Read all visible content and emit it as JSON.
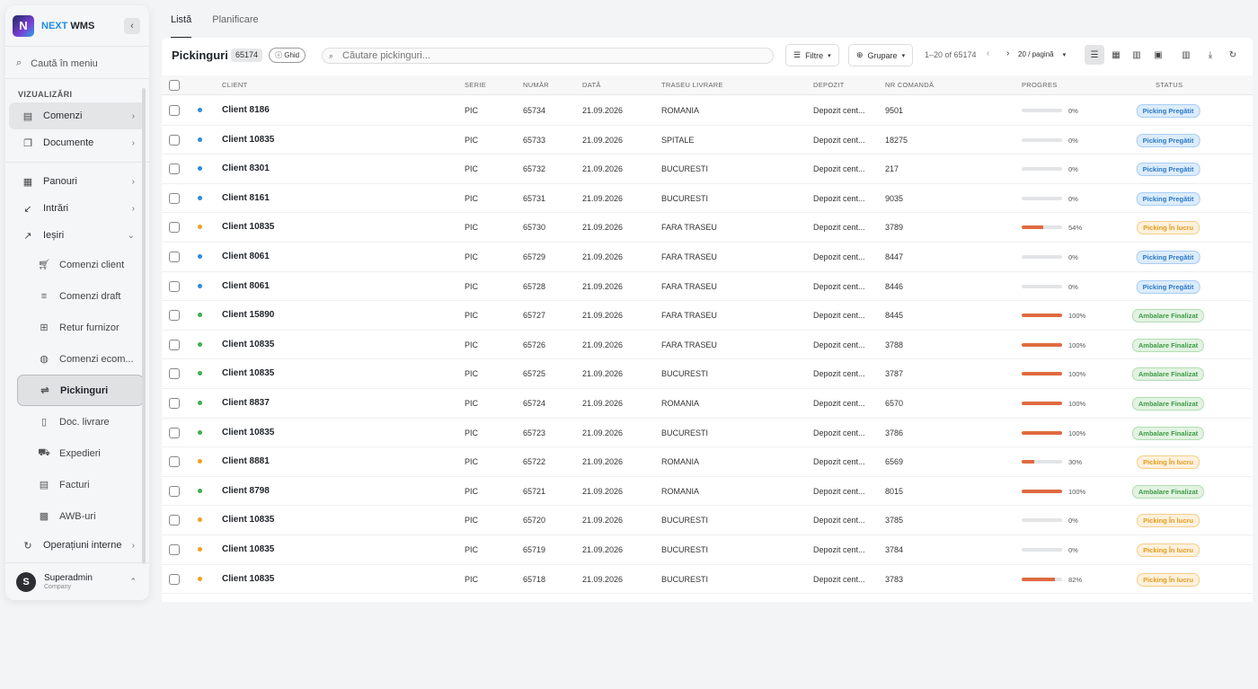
{
  "app": {
    "brand_prefix": "NEXT",
    "brand_suffix": "WMS",
    "logo_letter": "N"
  },
  "sidebar": {
    "search_placeholder": "Caută în meniu",
    "section_label": "VIZUALIZĂRI",
    "items": [
      {
        "label": "Comenzi",
        "icon": "list-box-icon"
      },
      {
        "label": "Documente",
        "icon": "documents-icon"
      },
      {
        "label": "Panouri",
        "icon": "dashboard-icon"
      },
      {
        "label": "Intrări",
        "icon": "arrow-in-icon"
      },
      {
        "label": "Ieșiri",
        "icon": "arrow-out-icon"
      }
    ],
    "sub_items": [
      {
        "label": "Comenzi client",
        "icon": "cart-icon"
      },
      {
        "label": "Comenzi draft",
        "icon": "draft-icon"
      },
      {
        "label": "Retur furnizor",
        "icon": "return-icon"
      },
      {
        "label": "Comenzi ecom...",
        "icon": "globe-icon"
      },
      {
        "label": "Pickinguri",
        "icon": "picking-icon"
      },
      {
        "label": "Doc. livrare",
        "icon": "delivery-doc-icon"
      },
      {
        "label": "Expedieri",
        "icon": "truck-icon"
      },
      {
        "label": "Facturi",
        "icon": "invoice-icon"
      },
      {
        "label": "AWB-uri",
        "icon": "qr-icon"
      }
    ],
    "last_item": {
      "label": "Operațiuni interne",
      "icon": "operations-icon"
    },
    "user": {
      "initial": "S",
      "name": "Superadmin",
      "company": "Company"
    }
  },
  "tabs": [
    {
      "label": "Listă"
    },
    {
      "label": "Planificare"
    }
  ],
  "toolbar": {
    "title": "Pickinguri",
    "count": "65174",
    "guide_label": "Ghid",
    "search_placeholder": "Căutare pickinguri...",
    "filter_label": "Filtre",
    "group_label": "Grupare",
    "page_info": "1–20 of 65174",
    "page_size": "20 / pagină"
  },
  "columns": {
    "client": "CLIENT",
    "serie": "SERIE",
    "numar": "NUMĂR",
    "data": "DATĂ",
    "traseu": "TRASEU LIVRARE",
    "depozit": "DEPOZIT",
    "nr_comanda": "NR COMANDĂ",
    "progres": "PROGRES",
    "status": "STATUS"
  },
  "colors": {
    "blue": "#2a8be0",
    "orange": "#f0a020",
    "green": "#3fae4f",
    "progress": "#e06a40"
  },
  "rows": [
    {
      "client": "Client 8186",
      "serie": "PIC",
      "numar": "65734",
      "data": "21.09.2026",
      "traseu": "ROMANIA",
      "depozit": "Depozit cent...",
      "nr_comanda": "9501",
      "progress": 0,
      "progress_label": "0%",
      "status": "Picking Pregătit",
      "tone": "blue"
    },
    {
      "client": "Client 10835",
      "serie": "PIC",
      "numar": "65733",
      "data": "21.09.2026",
      "traseu": "SPITALE",
      "depozit": "Depozit cent...",
      "nr_comanda": "18275",
      "progress": 0,
      "progress_label": "0%",
      "status": "Picking Pregătit",
      "tone": "blue"
    },
    {
      "client": "Client 8301",
      "serie": "PIC",
      "numar": "65732",
      "data": "21.09.2026",
      "traseu": "BUCURESTI",
      "depozit": "Depozit cent...",
      "nr_comanda": "217",
      "progress": 0,
      "progress_label": "0%",
      "status": "Picking Pregătit",
      "tone": "blue"
    },
    {
      "client": "Client 8161",
      "serie": "PIC",
      "numar": "65731",
      "data": "21.09.2026",
      "traseu": "BUCURESTI",
      "depozit": "Depozit cent...",
      "nr_comanda": "9035",
      "progress": 0,
      "progress_label": "0%",
      "status": "Picking Pregătit",
      "tone": "blue"
    },
    {
      "client": "Client 10835",
      "serie": "PIC",
      "numar": "65730",
      "data": "21.09.2026",
      "traseu": "FARA TRASEU",
      "depozit": "Depozit cent...",
      "nr_comanda": "3789",
      "progress": 54,
      "progress_label": "54%",
      "status": "Picking În lucru",
      "tone": "orange"
    },
    {
      "client": "Client 8061",
      "serie": "PIC",
      "numar": "65729",
      "data": "21.09.2026",
      "traseu": "FARA TRASEU",
      "depozit": "Depozit cent...",
      "nr_comanda": "8447",
      "progress": 0,
      "progress_label": "0%",
      "status": "Picking Pregătit",
      "tone": "blue"
    },
    {
      "client": "Client 8061",
      "serie": "PIC",
      "numar": "65728",
      "data": "21.09.2026",
      "traseu": "FARA TRASEU",
      "depozit": "Depozit cent...",
      "nr_comanda": "8446",
      "progress": 0,
      "progress_label": "0%",
      "status": "Picking Pregătit",
      "tone": "blue"
    },
    {
      "client": "Client 15890",
      "serie": "PIC",
      "numar": "65727",
      "data": "21.09.2026",
      "traseu": "FARA TRASEU",
      "depozit": "Depozit cent...",
      "nr_comanda": "8445",
      "progress": 100,
      "progress_label": "100%",
      "status": "Ambalare Finalizat",
      "tone": "green"
    },
    {
      "client": "Client 10835",
      "serie": "PIC",
      "numar": "65726",
      "data": "21.09.2026",
      "traseu": "FARA TRASEU",
      "depozit": "Depozit cent...",
      "nr_comanda": "3788",
      "progress": 100,
      "progress_label": "100%",
      "status": "Ambalare Finalizat",
      "tone": "green"
    },
    {
      "client": "Client 10835",
      "serie": "PIC",
      "numar": "65725",
      "data": "21.09.2026",
      "traseu": "BUCURESTI",
      "depozit": "Depozit cent...",
      "nr_comanda": "3787",
      "progress": 100,
      "progress_label": "100%",
      "status": "Ambalare Finalizat",
      "tone": "green"
    },
    {
      "client": "Client 8837",
      "serie": "PIC",
      "numar": "65724",
      "data": "21.09.2026",
      "traseu": "ROMANIA",
      "depozit": "Depozit cent...",
      "nr_comanda": "6570",
      "progress": 100,
      "progress_label": "100%",
      "status": "Ambalare Finalizat",
      "tone": "green"
    },
    {
      "client": "Client 10835",
      "serie": "PIC",
      "numar": "65723",
      "data": "21.09.2026",
      "traseu": "BUCURESTI",
      "depozit": "Depozit cent...",
      "nr_comanda": "3786",
      "progress": 100,
      "progress_label": "100%",
      "status": "Ambalare Finalizat",
      "tone": "green"
    },
    {
      "client": "Client 8881",
      "serie": "PIC",
      "numar": "65722",
      "data": "21.09.2026",
      "traseu": "ROMANIA",
      "depozit": "Depozit cent...",
      "nr_comanda": "6569",
      "progress": 30,
      "progress_label": "30%",
      "status": "Picking În lucru",
      "tone": "orange"
    },
    {
      "client": "Client 8798",
      "serie": "PIC",
      "numar": "65721",
      "data": "21.09.2026",
      "traseu": "ROMANIA",
      "depozit": "Depozit cent...",
      "nr_comanda": "8015",
      "progress": 100,
      "progress_label": "100%",
      "status": "Ambalare Finalizat",
      "tone": "green"
    },
    {
      "client": "Client 10835",
      "serie": "PIC",
      "numar": "65720",
      "data": "21.09.2026",
      "traseu": "BUCURESTI",
      "depozit": "Depozit cent...",
      "nr_comanda": "3785",
      "progress": 0,
      "progress_label": "0%",
      "status": "Picking În lucru",
      "tone": "orange"
    },
    {
      "client": "Client 10835",
      "serie": "PIC",
      "numar": "65719",
      "data": "21.09.2026",
      "traseu": "BUCURESTI",
      "depozit": "Depozit cent...",
      "nr_comanda": "3784",
      "progress": 0,
      "progress_label": "0%",
      "status": "Picking În lucru",
      "tone": "orange"
    },
    {
      "client": "Client 10835",
      "serie": "PIC",
      "numar": "65718",
      "data": "21.09.2026",
      "traseu": "BUCURESTI",
      "depozit": "Depozit cent...",
      "nr_comanda": "3783",
      "progress": 82,
      "progress_label": "82%",
      "status": "Picking În lucru",
      "tone": "orange"
    }
  ]
}
